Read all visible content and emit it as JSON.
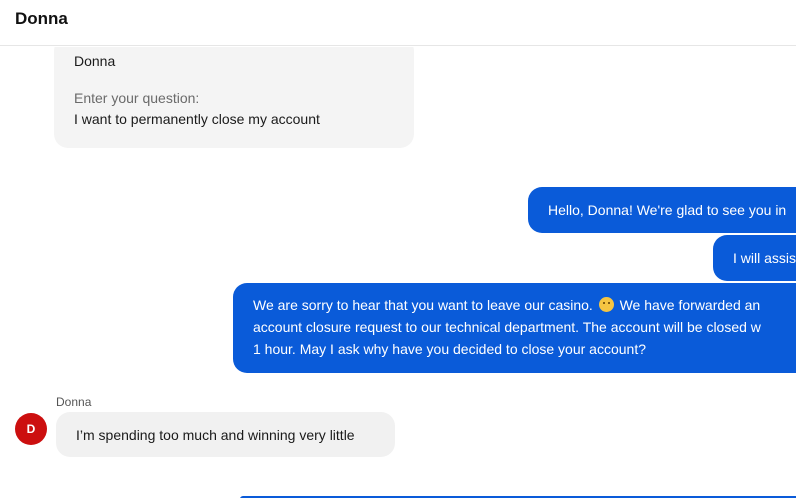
{
  "header": {
    "title": "Donna"
  },
  "form_card": {
    "name": "Donna",
    "question_label": "Enter your question:",
    "question_value": "I want to permanently close my account"
  },
  "messages_out": [
    {
      "text": "Hello, Donna! We're glad to see you in"
    },
    {
      "text": "I will assis"
    },
    {
      "line1_before_emoji": "We are sorry to hear that you want to leave our casino.",
      "line1_after_emoji": "We have forwarded an",
      "line2": "account closure request to our technical department. The account will be closed w",
      "line3": "1 hour. May I ask why have you decided to close your account?",
      "emoji": "sad-face-emoji"
    }
  ],
  "incoming": {
    "sender_name": "Donna",
    "avatar_initial": "D",
    "avatar_color": "#cc0f0f",
    "text": "I’m spending too much and winning very little"
  },
  "colors": {
    "outgoing_bubble": "#0a5bd9",
    "incoming_bubble": "#f1f1f1",
    "form_card": "#f4f4f4"
  }
}
